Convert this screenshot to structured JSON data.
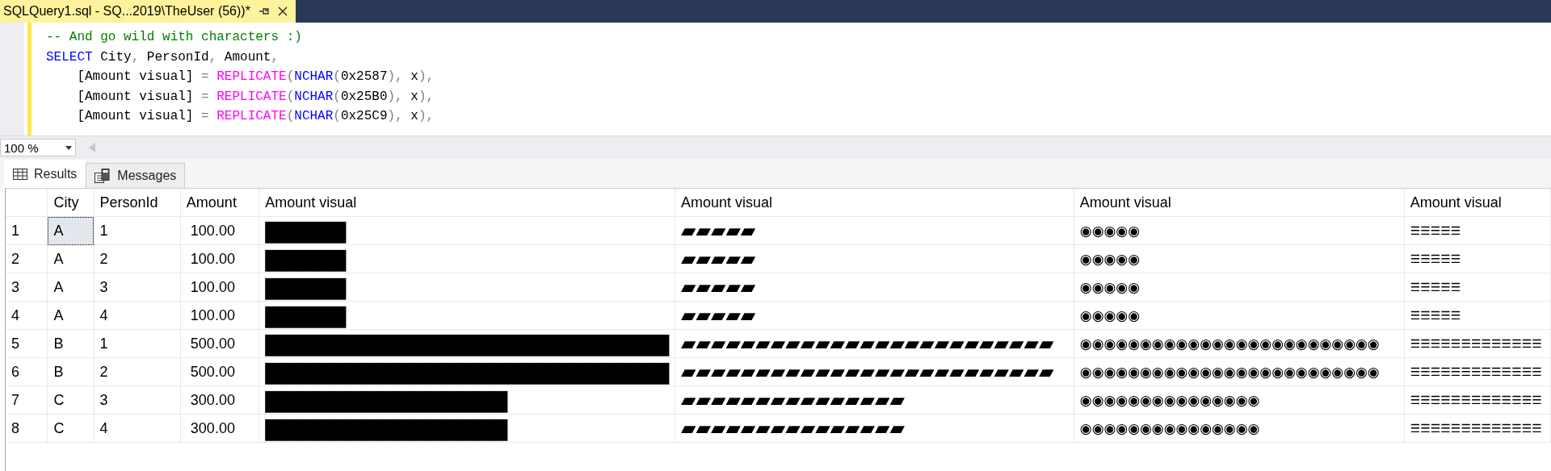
{
  "editor_tab": {
    "title": "SQLQuery1.sql - SQ...2019\\TheUser (56))*",
    "selected": true
  },
  "code_lines": [
    [
      {
        "kind": "comment",
        "text": "-- And go wild with characters :)"
      }
    ],
    [
      {
        "kind": "keyword",
        "text": "SELECT"
      },
      {
        "kind": "plain",
        "text": " City"
      },
      {
        "kind": "op",
        "text": ", "
      },
      {
        "kind": "plain",
        "text": "PersonId"
      },
      {
        "kind": "op",
        "text": ", "
      },
      {
        "kind": "plain",
        "text": "Amount"
      },
      {
        "kind": "op",
        "text": ","
      }
    ],
    [
      {
        "kind": "plain",
        "text": "    [Amount visual]"
      },
      {
        "kind": "op",
        "text": " = "
      },
      {
        "kind": "function",
        "text": "REPLICATE"
      },
      {
        "kind": "op",
        "text": "("
      },
      {
        "kind": "keyword",
        "text": "NCHAR"
      },
      {
        "kind": "op",
        "text": "("
      },
      {
        "kind": "plain",
        "text": "0x2587"
      },
      {
        "kind": "op",
        "text": "), "
      },
      {
        "kind": "plain",
        "text": "x"
      },
      {
        "kind": "op",
        "text": "),"
      }
    ],
    [
      {
        "kind": "plain",
        "text": "    [Amount visual]"
      },
      {
        "kind": "op",
        "text": " = "
      },
      {
        "kind": "function",
        "text": "REPLICATE"
      },
      {
        "kind": "op",
        "text": "("
      },
      {
        "kind": "keyword",
        "text": "NCHAR"
      },
      {
        "kind": "op",
        "text": "("
      },
      {
        "kind": "plain",
        "text": "0x25B0"
      },
      {
        "kind": "op",
        "text": "), "
      },
      {
        "kind": "plain",
        "text": "x"
      },
      {
        "kind": "op",
        "text": "),"
      }
    ],
    [
      {
        "kind": "plain",
        "text": "    [Amount visual]"
      },
      {
        "kind": "op",
        "text": " = "
      },
      {
        "kind": "function",
        "text": "REPLICATE"
      },
      {
        "kind": "op",
        "text": "("
      },
      {
        "kind": "keyword",
        "text": "NCHAR"
      },
      {
        "kind": "op",
        "text": "("
      },
      {
        "kind": "plain",
        "text": "0x25C9"
      },
      {
        "kind": "op",
        "text": "), "
      },
      {
        "kind": "plain",
        "text": "x"
      },
      {
        "kind": "op",
        "text": "),"
      }
    ]
  ],
  "zoom": {
    "value": "100 %"
  },
  "result_tabs": [
    {
      "label": "Results",
      "kind": "grid",
      "selected": true
    },
    {
      "label": "Messages",
      "kind": "messages",
      "selected": false
    }
  ],
  "grid": {
    "columns": [
      "City",
      "PersonId",
      "Amount",
      "Amount visual",
      "Amount visual",
      "Amount visual",
      "Amount visual"
    ],
    "rows": [
      {
        "number": "1",
        "focused": true,
        "cells": [
          "A",
          "1",
          "100.00",
          "▇▇▇▇▇",
          "▰▰▰▰▰",
          "◉◉◉◉◉",
          "☰☰☰☰☰"
        ]
      },
      {
        "number": "2",
        "focused": false,
        "cells": [
          "A",
          "2",
          "100.00",
          "▇▇▇▇▇",
          "▰▰▰▰▰",
          "◉◉◉◉◉",
          "☰☰☰☰☰"
        ]
      },
      {
        "number": "3",
        "focused": false,
        "cells": [
          "A",
          "3",
          "100.00",
          "▇▇▇▇▇",
          "▰▰▰▰▰",
          "◉◉◉◉◉",
          "☰☰☰☰☰"
        ]
      },
      {
        "number": "4",
        "focused": false,
        "cells": [
          "A",
          "4",
          "100.00",
          "▇▇▇▇▇",
          "▰▰▰▰▰",
          "◉◉◉◉◉",
          "☰☰☰☰☰"
        ]
      },
      {
        "number": "5",
        "focused": false,
        "cells": [
          "B",
          "1",
          "500.00",
          "▇▇▇▇▇▇▇▇▇▇▇▇▇▇▇▇▇▇▇▇▇▇▇▇▇",
          "▰▰▰▰▰▰▰▰▰▰▰▰▰▰▰▰▰▰▰▰▰▰▰▰▰",
          "◉◉◉◉◉◉◉◉◉◉◉◉◉◉◉◉◉◉◉◉◉◉◉◉◉",
          "☰☰☰☰☰☰☰☰☰☰☰☰☰"
        ]
      },
      {
        "number": "6",
        "focused": false,
        "cells": [
          "B",
          "2",
          "500.00",
          "▇▇▇▇▇▇▇▇▇▇▇▇▇▇▇▇▇▇▇▇▇▇▇▇▇",
          "▰▰▰▰▰▰▰▰▰▰▰▰▰▰▰▰▰▰▰▰▰▰▰▰▰",
          "◉◉◉◉◉◉◉◉◉◉◉◉◉◉◉◉◉◉◉◉◉◉◉◉◉",
          "☰☰☰☰☰☰☰☰☰☰☰☰☰"
        ]
      },
      {
        "number": "7",
        "focused": false,
        "cells": [
          "C",
          "3",
          "300.00",
          "▇▇▇▇▇▇▇▇▇▇▇▇▇▇▇",
          "▰▰▰▰▰▰▰▰▰▰▰▰▰▰▰",
          "◉◉◉◉◉◉◉◉◉◉◉◉◉◉◉",
          "☰☰☰☰☰☰☰☰☰☰☰☰☰"
        ]
      },
      {
        "number": "8",
        "focused": false,
        "cells": [
          "C",
          "4",
          "300.00",
          "▇▇▇▇▇▇▇▇▇▇▇▇▇▇▇",
          "▰▰▰▰▰▰▰▰▰▰▰▰▰▰▰",
          "◉◉◉◉◉◉◉◉◉◉◉◉◉◉◉",
          "☰☰☰☰☰☰☰☰☰☰☰☰☰"
        ]
      }
    ]
  }
}
